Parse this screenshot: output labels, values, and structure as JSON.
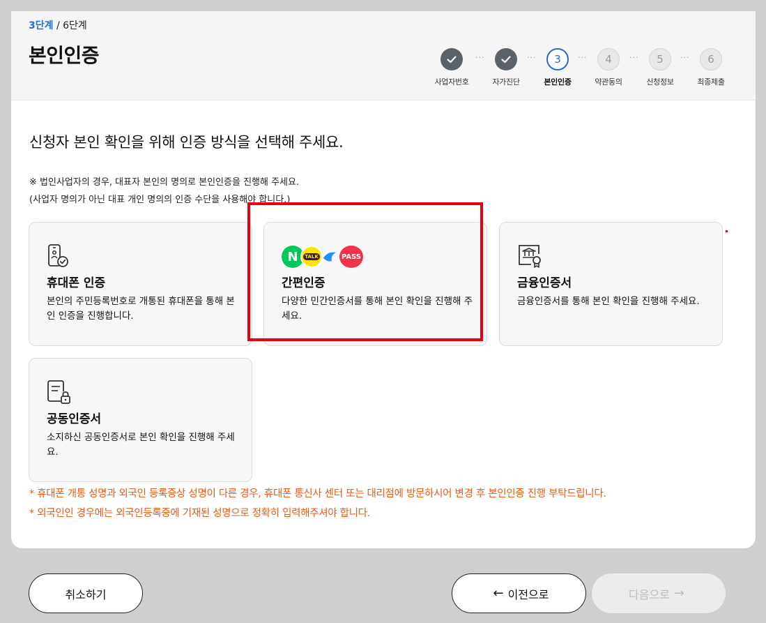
{
  "header": {
    "step_current": "3단계",
    "step_total": " / 6단계",
    "title": "본인인증"
  },
  "stepper": {
    "steps": [
      {
        "label": "사업자번호",
        "status": "done",
        "number": ""
      },
      {
        "label": "자가진단",
        "status": "done",
        "number": ""
      },
      {
        "label": "본인인증",
        "status": "current",
        "number": "3"
      },
      {
        "label": "약관동의",
        "status": "todo",
        "number": "4"
      },
      {
        "label": "신청정보",
        "status": "todo",
        "number": "5"
      },
      {
        "label": "최종제출",
        "status": "todo",
        "number": "6"
      }
    ],
    "separator": "···"
  },
  "main": {
    "lead": "신청자 본인 확인을 위해 인증 방식을 선택해 주세요.",
    "note_line1": "※ 법인사업자의 경우, 대표자 본인의 명의로 본인인증을 진행해 주세요.",
    "note_line2": "(사업자 명의가 아닌 대표 개인 명의의 인증 수단을 사용해야 합니다.)"
  },
  "cards": [
    {
      "title": "휴대폰 인증",
      "desc": "본인의 주민등록번호로 개통된 휴대폰을 통해 본인 인증을 진행합니다.",
      "icon": "phone-check-icon"
    },
    {
      "title": "간편인증",
      "desc": "다양한 민간인증서를 통해 본인 확인을 진행해 주세요.",
      "icon": "simple-auth-logos",
      "logos": [
        {
          "text": "N",
          "color": "#03c75a"
        },
        {
          "text": "TALK",
          "color": "#fee500"
        },
        {
          "text": "",
          "color": "#1e90ff"
        },
        {
          "text": "PASS",
          "color": "#f0324b"
        }
      ]
    },
    {
      "title": "금융인증서",
      "desc": "금융인증서를 통해 본인 확인을 진행해 주세요.",
      "icon": "bank-certificate-icon"
    },
    {
      "title": "공동인증서",
      "desc": "소지하신 공동인증서로 본인 확인을 진행해 주세요.",
      "icon": "document-lock-icon"
    }
  ],
  "warnings": [
    "* 휴대폰 개통 성명과 외국인 등록증상 성명이 다른 경우, 휴대폰 통신사 센터 또는 대리점에 방문하시어 변경 후 본인인증 진행 부탁드립니다.",
    "* 외국인인 경우에는 외국인등록증에 기재된 성명으로 정확히 입력해주셔야 합니다."
  ],
  "footer": {
    "cancel": "취소하기",
    "prev": "이전으로",
    "next": "다음으로"
  },
  "colors": {
    "accent": "#1f6fd1",
    "warning": "#f05a12",
    "highlight": "#e60012",
    "done": "#5a6169"
  }
}
